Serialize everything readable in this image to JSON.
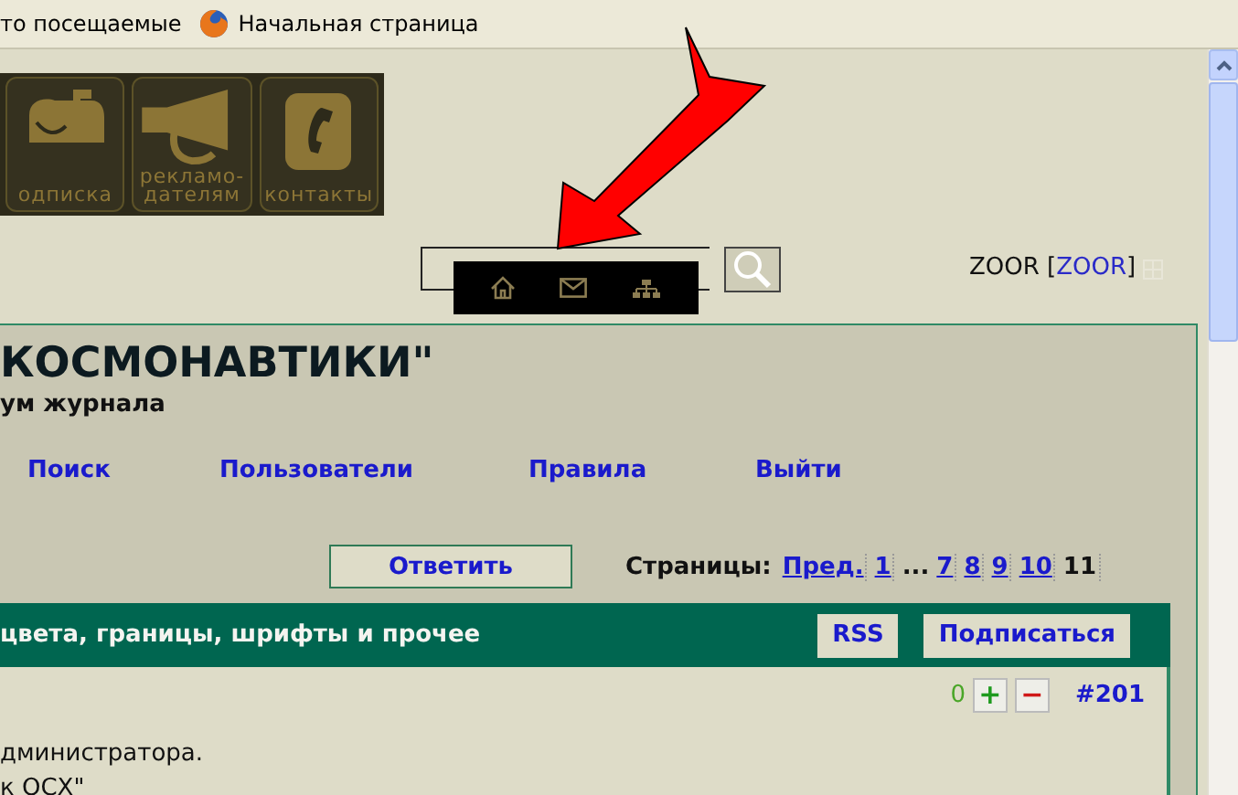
{
  "bookmarks": [
    {
      "label": "то посещаемые",
      "kind": "plain"
    },
    {
      "label": "Начальная страница",
      "kind": "browser"
    }
  ],
  "banner_tiles": [
    {
      "kind": "mailbox",
      "lines": [
        "одписка"
      ]
    },
    {
      "kind": "megaphone",
      "lines": [
        "рекламо-",
        "дателям"
      ]
    },
    {
      "kind": "phone",
      "lines": [
        "контакты"
      ]
    }
  ],
  "quick_icons": [
    {
      "kind": "home"
    },
    {
      "kind": "mail"
    },
    {
      "kind": "hierarchy"
    }
  ],
  "user": {
    "name": "ZOOR",
    "bracket_open": "[",
    "link": "ZOOR",
    "bracket_close": "]"
  },
  "forum": {
    "title": "КОСМОНАВТИКИ\"",
    "subtitle": "ум журнала",
    "nav": [
      "Поиск",
      "Пользователи",
      "Правила",
      "Выйти"
    ],
    "reply_button": "Ответить",
    "pages_label": "Страницы:",
    "pages": [
      {
        "label": "Пред.",
        "kind": "link",
        "selected": false
      },
      {
        "label": "1",
        "kind": "link",
        "selected": false
      },
      {
        "label": "...",
        "kind": "gap"
      },
      {
        "label": "7",
        "kind": "link",
        "selected": false
      },
      {
        "label": "8",
        "kind": "link",
        "selected": false
      },
      {
        "label": "9",
        "kind": "link",
        "selected": false
      },
      {
        "label": "10",
        "kind": "link",
        "selected": false
      },
      {
        "label": "11",
        "kind": "link",
        "selected": true
      }
    ],
    "topic": "цвета, границы, шрифты и прочее",
    "topic_buttons": [
      "RSS",
      "Подписаться"
    ],
    "post": {
      "rating": "0",
      "plus": "+",
      "minus": "−",
      "number": "#201",
      "lines": [
        "дминистратора.",
        "к ОСХ\""
      ]
    }
  }
}
